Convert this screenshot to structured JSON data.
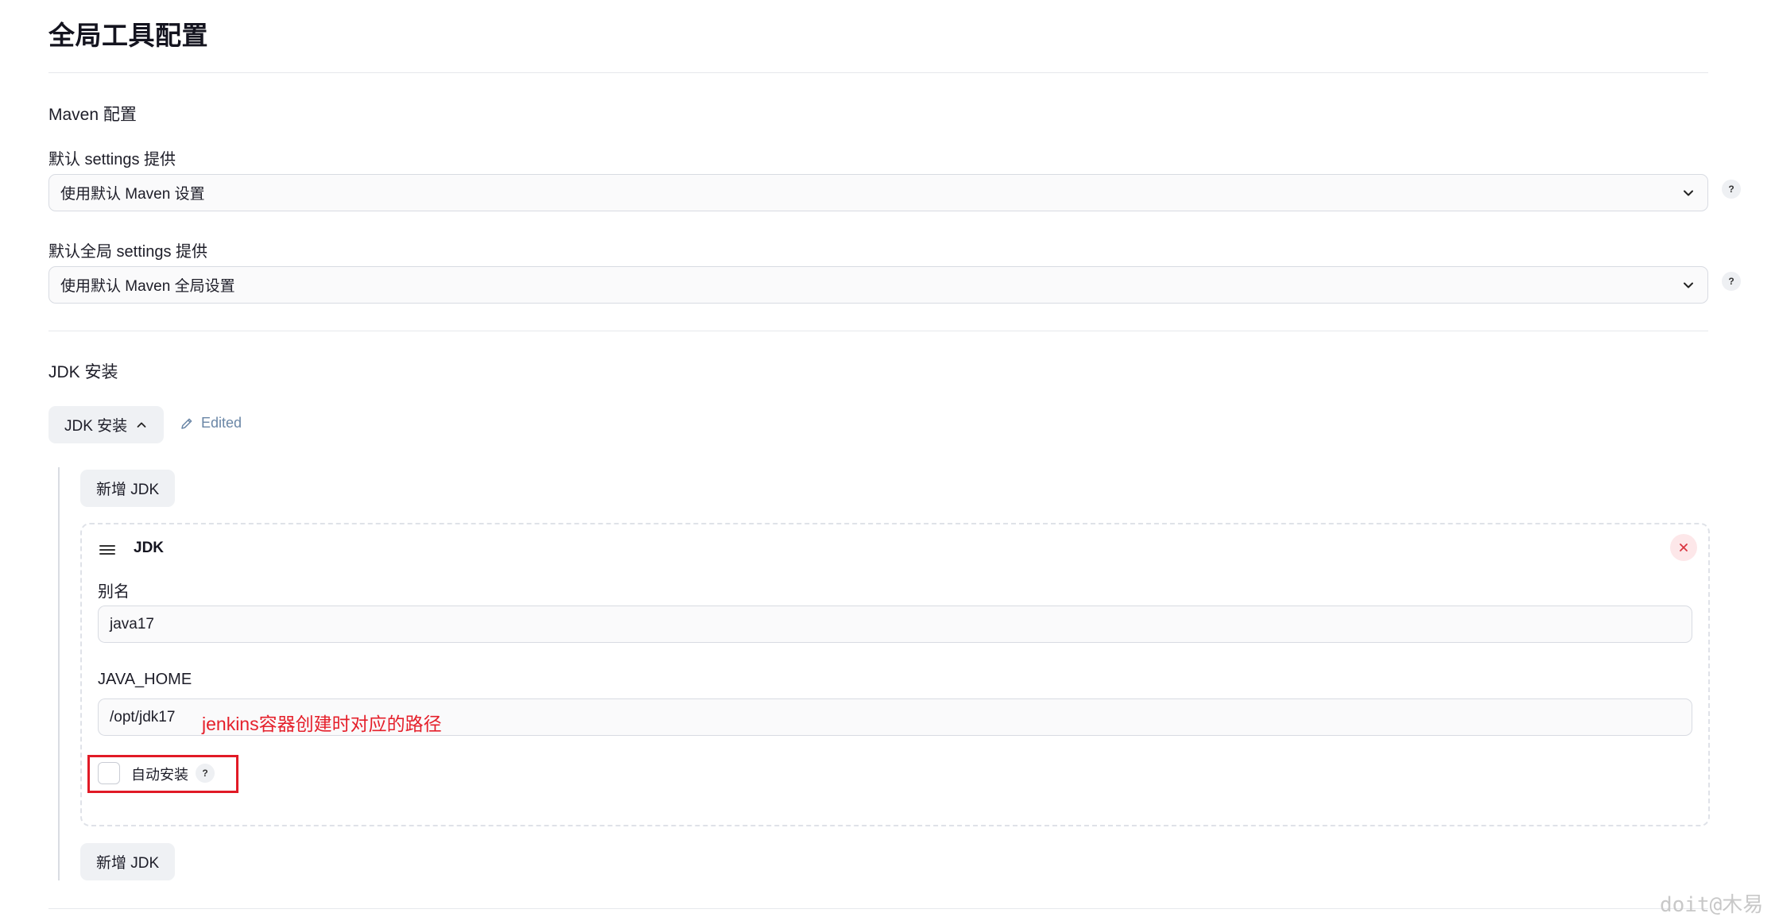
{
  "page": {
    "title": "全局工具配置"
  },
  "maven": {
    "section_title": "Maven 配置",
    "settings_label": "默认 settings 提供",
    "settings_value": "使用默认 Maven 设置",
    "global_settings_label": "默认全局 settings 提供",
    "global_settings_value": "使用默认 Maven 全局设置"
  },
  "jdk": {
    "section_title": "JDK 安装",
    "toggle_label": "JDK 安装",
    "edited_label": "Edited",
    "add_button_label": "新增 JDK",
    "card": {
      "title": "JDK",
      "alias_label": "别名",
      "alias_value": "java17",
      "java_home_label": "JAVA_HOME",
      "java_home_value": "/opt/jdk17",
      "auto_install_label": "自动安装",
      "auto_install_checked": false
    }
  },
  "annotation": {
    "text": "jenkins容器创建时对应的路径",
    "color": "#e5202b"
  },
  "help": {
    "symbol": "?"
  },
  "watermark": {
    "text": "doit@木易"
  },
  "icons": [
    "chevron-down-icon",
    "chevron-up-icon",
    "pencil-icon",
    "drag-handle-icon",
    "close-icon",
    "help-icon"
  ]
}
